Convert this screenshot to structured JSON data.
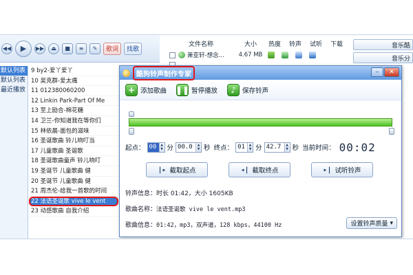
{
  "toolbar": {
    "lyrics_label": "歌词",
    "search_label": "找歌"
  },
  "sidebar": {
    "items": [
      "默认列表",
      "默认列表",
      "最近播放"
    ]
  },
  "playlist": {
    "songs": [
      "9 by2-爱丫爱丫",
      "10 吴克群-爱太痛",
      "11 012380060200",
      "12 Linkin Park-Part Of Me",
      "13 至上励合-棉花糖",
      "14 卫兰-你知道我在等你们",
      "15 林依晨-面包的滋味",
      "16 圣诞歌曲 铃儿响叮当",
      "17 儿童歌曲 圣诞歌",
      "18 圣诞歌曲童声 铃儿响叮",
      "19 圣诞节 儿童歌曲 健",
      "20 圣诞节 儿童歌曲 健",
      "21 周杰伦-给我一首歌的时间",
      "22 法语圣诞歌 vive le vent",
      "23 动感歌曲 自我介绍"
    ],
    "selected_index": 13
  },
  "results": {
    "columns": [
      "文件名称",
      "大小",
      "热度",
      "铃声",
      "试听",
      "下载"
    ],
    "rows": [
      {
        "name": "萧亚轩-想念...",
        "size": "4.67 MB"
      },
      {
        "name": "",
        "size": ""
      }
    ]
  },
  "right_panel": {
    "buttons": [
      "音乐酷",
      "音乐分"
    ]
  },
  "dialog": {
    "title": "酷狗铃声制作专家",
    "tools": {
      "add": "添加歌曲",
      "pause": "暂停播放",
      "save": "保存铃声"
    },
    "times": {
      "start_label": "起点：",
      "start_min": "00",
      "start_sec": "00.0",
      "end_label": "终点：",
      "end_min": "01",
      "end_sec": "42.7",
      "min_unit": "分",
      "sec_unit": "秒",
      "current_label": "当前时间：",
      "current_time": "00:02"
    },
    "actions": {
      "cut_start": "截取起点",
      "cut_end": "截取终点",
      "preview": "试听铃声"
    },
    "info": {
      "ringtone": "铃声信息：时长 01:42，大小 1605KB",
      "song_name_label": "歌曲名称：",
      "song_name": "法语圣诞歌 vive le vent.mp3",
      "song_info_label": "歌曲信息：",
      "song_info": "01:42，mp3，双声道，128 kbps，44100 Hz"
    },
    "quality_button": "设置铃声质量"
  }
}
